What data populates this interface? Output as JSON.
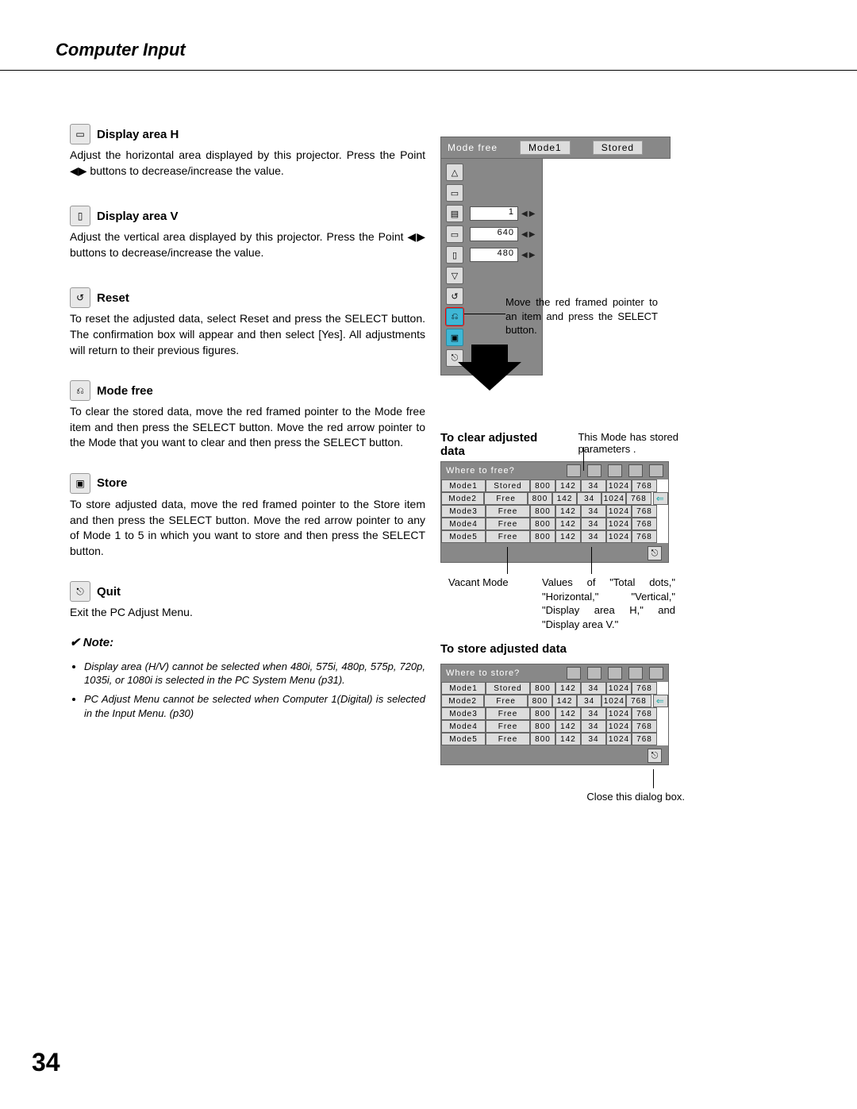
{
  "header": {
    "title": "Computer Input"
  },
  "sections": [
    {
      "title": "Display area H",
      "body": "Adjust the horizontal area displayed by this projector.  Press the Point ◀▶ buttons to decrease/increase the value."
    },
    {
      "title": "Display area V",
      "body": "Adjust the vertical area displayed by this projector.  Press the Point ◀▶ buttons to decrease/increase the value."
    },
    {
      "title": "Reset",
      "body": "To reset the adjusted data, select Reset and press the SELECT button.  The confirmation box will appear and then select [Yes].  All adjustments will return to their previous figures."
    },
    {
      "title": "Mode free",
      "body": "To clear the stored data, move the red framed pointer to the Mode free item and then press the SELECT button.  Move the red arrow pointer to the Mode that you want to clear and then press the SELECT button."
    },
    {
      "title": "Store",
      "body": "To store adjusted data, move the red framed pointer to the Store item and then press the SELECT button.  Move the red arrow pointer to any of Mode 1 to 5 in which you want to store and then press the SELECT button."
    },
    {
      "title": "Quit",
      "body": "Exit the PC Adjust Menu."
    }
  ],
  "note": {
    "head": "✔ Note:",
    "items": [
      "Display area (H/V) cannot be selected when 480i, 575i, 480p, 575p, 720p, 1035i, or 1080i is selected in the PC System Menu (p31).",
      "PC Adjust Menu cannot be selected when Computer 1(Digital) is selected in the Input Menu.  (p30)"
    ]
  },
  "menu1": {
    "tab_left": "Mode free",
    "tab_mid": "Mode1",
    "tab_right": "Stored",
    "vals": {
      "a": "1",
      "b": "640",
      "c": "480"
    },
    "hint": "Move the red framed pointer to an item and press the SELECT button."
  },
  "tclear": {
    "title": "To clear adjusted data",
    "side": "This Mode has stored parameters .",
    "tbl_head": "Where to free?",
    "rows": [
      {
        "m": "Mode1",
        "s": "Stored",
        "a": "800",
        "b": "142",
        "c": "34",
        "d": "1024",
        "e": "768"
      },
      {
        "m": "Mode2",
        "s": "Free",
        "a": "800",
        "b": "142",
        "c": "34",
        "d": "1024",
        "e": "768"
      },
      {
        "m": "Mode3",
        "s": "Free",
        "a": "800",
        "b": "142",
        "c": "34",
        "d": "1024",
        "e": "768"
      },
      {
        "m": "Mode4",
        "s": "Free",
        "a": "800",
        "b": "142",
        "c": "34",
        "d": "1024",
        "e": "768"
      },
      {
        "m": "Mode5",
        "s": "Free",
        "a": "800",
        "b": "142",
        "c": "34",
        "d": "1024",
        "e": "768"
      }
    ],
    "callout_left": "Vacant Mode",
    "callout_right": "Values of \"Total dots,\" \"Horizontal,\" \"Vertical,\" \"Display area H,\" and \"Display area V.\""
  },
  "tstore": {
    "title": "To store adjusted data",
    "tbl_head": "Where to store?",
    "rows": [
      {
        "m": "Mode1",
        "s": "Stored",
        "a": "800",
        "b": "142",
        "c": "34",
        "d": "1024",
        "e": "768"
      },
      {
        "m": "Mode2",
        "s": "Free",
        "a": "800",
        "b": "142",
        "c": "34",
        "d": "1024",
        "e": "768"
      },
      {
        "m": "Mode3",
        "s": "Free",
        "a": "800",
        "b": "142",
        "c": "34",
        "d": "1024",
        "e": "768"
      },
      {
        "m": "Mode4",
        "s": "Free",
        "a": "800",
        "b": "142",
        "c": "34",
        "d": "1024",
        "e": "768"
      },
      {
        "m": "Mode5",
        "s": "Free",
        "a": "800",
        "b": "142",
        "c": "34",
        "d": "1024",
        "e": "768"
      }
    ],
    "callout": "Close this dialog box."
  },
  "page_number": "34"
}
